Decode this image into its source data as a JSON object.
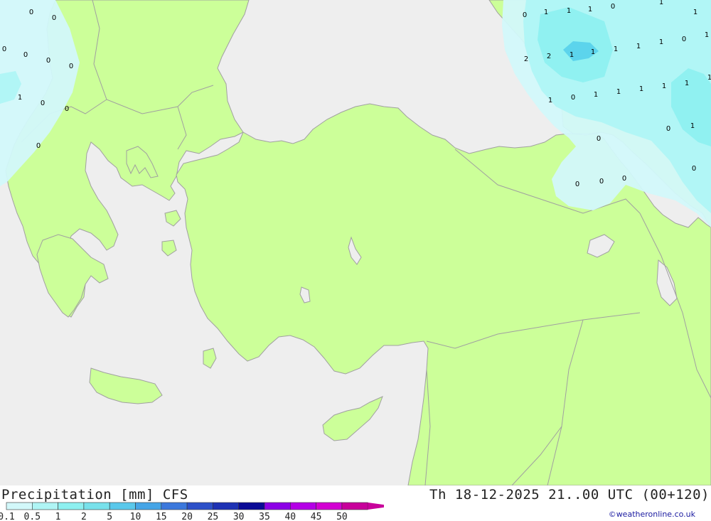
{
  "header": {
    "title": "Precipitation [mm] CFS",
    "datetime": "Th 18-12-2025 21..00 UTC (00+120)",
    "credit": "©weatheronline.co.uk"
  },
  "legend": {
    "ticks": [
      "0.1",
      "0.5",
      "1",
      "2",
      "5",
      "10",
      "15",
      "20",
      "25",
      "30",
      "35",
      "40",
      "45",
      "50"
    ],
    "colors": [
      "#d2f8fa",
      "#aff5f5",
      "#8ef0f0",
      "#78e1eb",
      "#5ac8eb",
      "#46a5e6",
      "#3c78dc",
      "#2d50c8",
      "#1e32b4",
      "#0a0a96",
      "#8c00e6",
      "#b400e6",
      "#d200d2",
      "#c8009b"
    ]
  },
  "colors": {
    "sea": "#eeeeee",
    "land": "#ccff99",
    "border": "#a0a0a0",
    "precip_light": "#d2f8fa",
    "precip_medium": "#aff5f5",
    "precip_strong": "#8ef0f0",
    "precip_heavy": "#5ad2eb"
  },
  "contour_labels": [
    {
      "text": "0"
    },
    {
      "text": "0"
    },
    {
      "text": "0"
    },
    {
      "text": "0"
    },
    {
      "text": "0"
    },
    {
      "text": "0"
    },
    {
      "text": "1"
    },
    {
      "text": "0"
    },
    {
      "text": "0"
    },
    {
      "text": "0"
    },
    {
      "text": "0"
    },
    {
      "text": "1"
    },
    {
      "text": "1"
    },
    {
      "text": "1"
    },
    {
      "text": "0"
    },
    {
      "text": "1"
    },
    {
      "text": "1"
    },
    {
      "text": "1"
    },
    {
      "text": "2"
    },
    {
      "text": "2"
    },
    {
      "text": "1"
    },
    {
      "text": "1"
    },
    {
      "text": "1"
    },
    {
      "text": "1"
    },
    {
      "text": "1"
    },
    {
      "text": "0"
    },
    {
      "text": "1"
    },
    {
      "text": "1"
    },
    {
      "text": "1"
    },
    {
      "text": "1"
    },
    {
      "text": "1"
    },
    {
      "text": "1"
    },
    {
      "text": "0"
    },
    {
      "text": "1"
    },
    {
      "text": "0"
    },
    {
      "text": "1"
    },
    {
      "text": "0"
    },
    {
      "text": "0"
    },
    {
      "text": "0"
    },
    {
      "text": "0"
    },
    {
      "text": "0"
    }
  ]
}
